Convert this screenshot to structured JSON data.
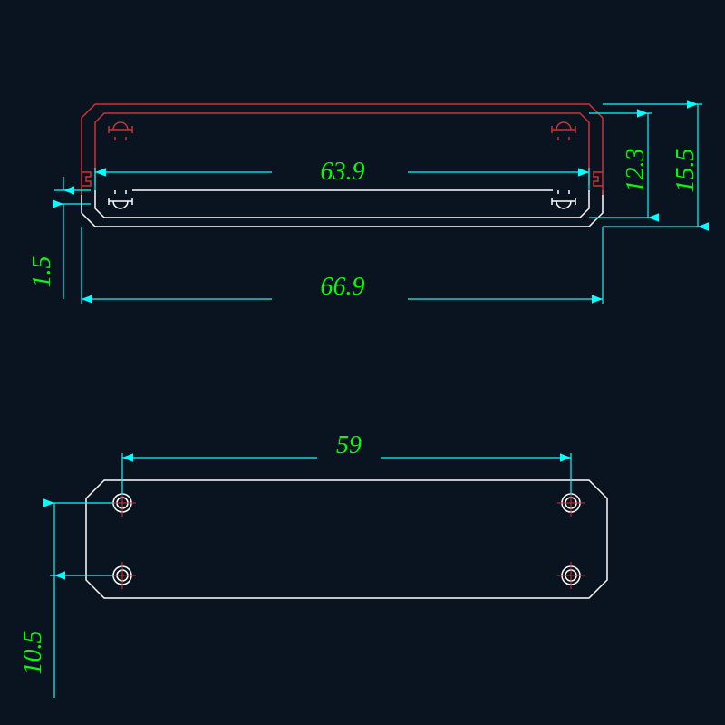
{
  "dimensions": {
    "inner_width": "63.9",
    "outer_width": "66.9",
    "inner_height": "12.3",
    "outer_height": "15.5",
    "wall": "1.5",
    "hole_spacing_x": "59",
    "hole_spacing_y": "10.5"
  },
  "colors": {
    "bg": "#0a1420",
    "dim_text": "#00ff00",
    "dim_line": "#00ffff",
    "profile_top": "#cc3333",
    "profile_bottom": "#ffffff",
    "center": "#cc3333"
  },
  "views": {
    "top": "extrusion-profile-cross-section",
    "bottom": "end-plate-hole-pattern"
  }
}
